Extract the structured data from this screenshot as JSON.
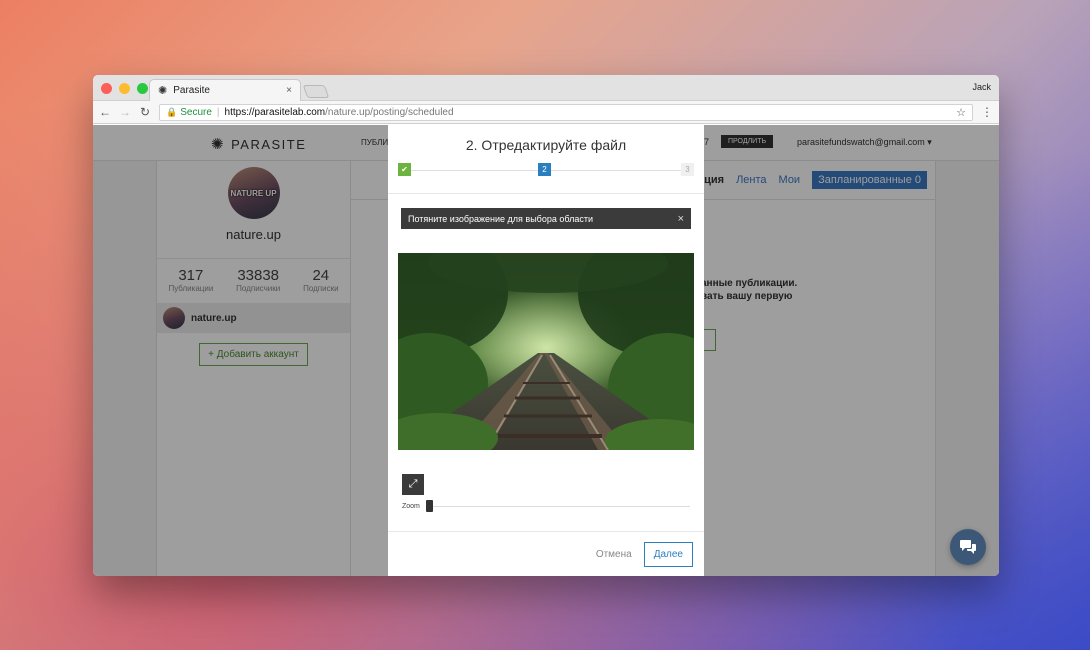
{
  "browser": {
    "profile_name": "Jack",
    "tab_title": "Parasite",
    "tab_close": "×",
    "url_secure": "Secure",
    "url_host": "https://parasitelab.com",
    "url_path": "/nature.up/posting/scheduled"
  },
  "site": {
    "logo_text": "PARASITE",
    "nav_publications_cut": "ПУБЛИ",
    "nav_number_cut": "7",
    "renew_label": "ПРОДЛИТЬ",
    "user_email": "parasitefundswatch@gmail.com"
  },
  "profile": {
    "avatar_text": "NATURE UP",
    "name": "nature.up",
    "stats": [
      {
        "value": "317",
        "label": "Публикации"
      },
      {
        "value": "33838",
        "label": "Подписчики"
      },
      {
        "value": "24",
        "label": "Подписки"
      }
    ],
    "account_name": "nature.up",
    "add_account_label": "+ Добавить аккаунт"
  },
  "main": {
    "tab_cut": "ация",
    "tab_feed": "Лента",
    "tab_mine": "Мои",
    "tab_scheduled": "Запланированные 0",
    "empty_line1": "анные публикации.",
    "empty_line2": "вать вашу первую"
  },
  "modal": {
    "title": "2. Отредактируйте файл",
    "step1": "✔",
    "step2": "2",
    "step3": "3",
    "hint": "Потяните изображение для выбора области",
    "hint_close": "×",
    "zoom_label": "Zoom",
    "zoom_level": 0,
    "cancel_label": "Отмена",
    "next_label": "Далее"
  },
  "colors": {
    "accent_blue": "#2a7fc1",
    "accent_green": "#6db33f",
    "scheduled_tab": "#3b78c2"
  }
}
